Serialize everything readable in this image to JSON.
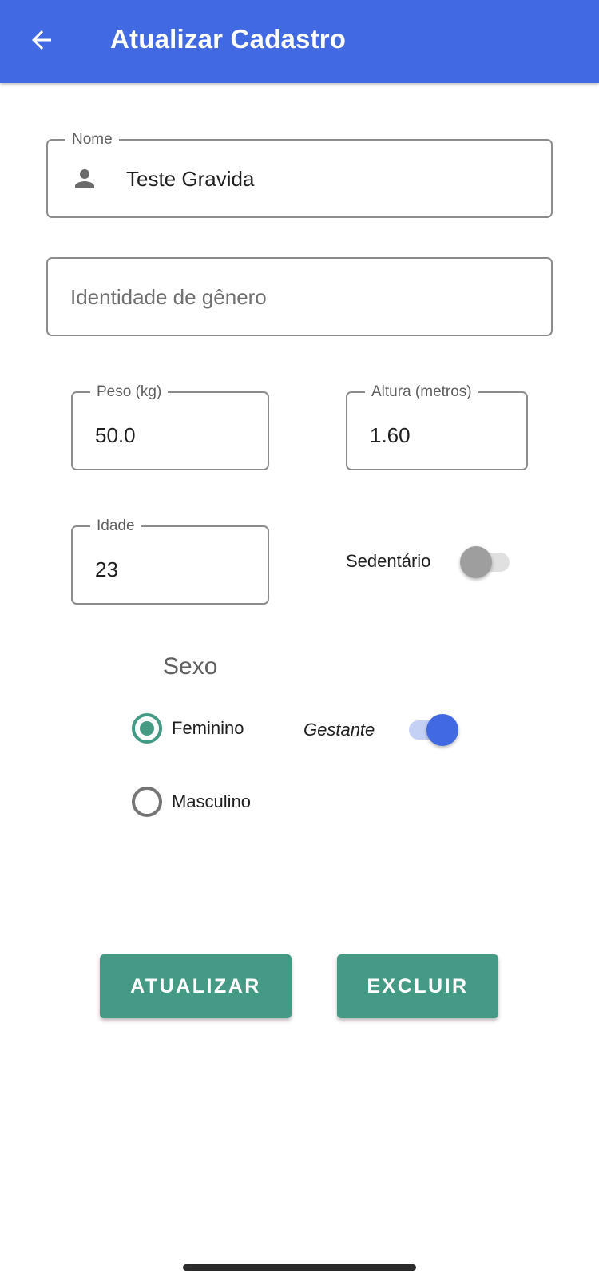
{
  "appbar": {
    "title": "Atualizar Cadastro",
    "back_icon": "arrow-left-icon",
    "background": "#4169e1"
  },
  "form": {
    "nome": {
      "label": "Nome",
      "value": "Teste Gravida",
      "icon": "person-icon"
    },
    "identidade_genero": {
      "placeholder": "Identidade de gênero",
      "value": ""
    },
    "peso": {
      "label": "Peso (kg)",
      "value": "50.0"
    },
    "altura": {
      "label": "Altura (metros)",
      "value": "1.60"
    },
    "idade": {
      "label": "Idade",
      "value": "23"
    },
    "sedentario": {
      "label": "Sedentário",
      "checked": false
    },
    "sexo": {
      "label": "Sexo",
      "options": [
        {
          "label": "Feminino",
          "selected": true
        },
        {
          "label": "Masculino",
          "selected": false
        }
      ]
    },
    "gestante": {
      "label": "Gestante",
      "checked": true
    }
  },
  "actions": {
    "update_label": "ATUALIZAR",
    "delete_label": "EXCLUIR",
    "color": "#459a86"
  }
}
